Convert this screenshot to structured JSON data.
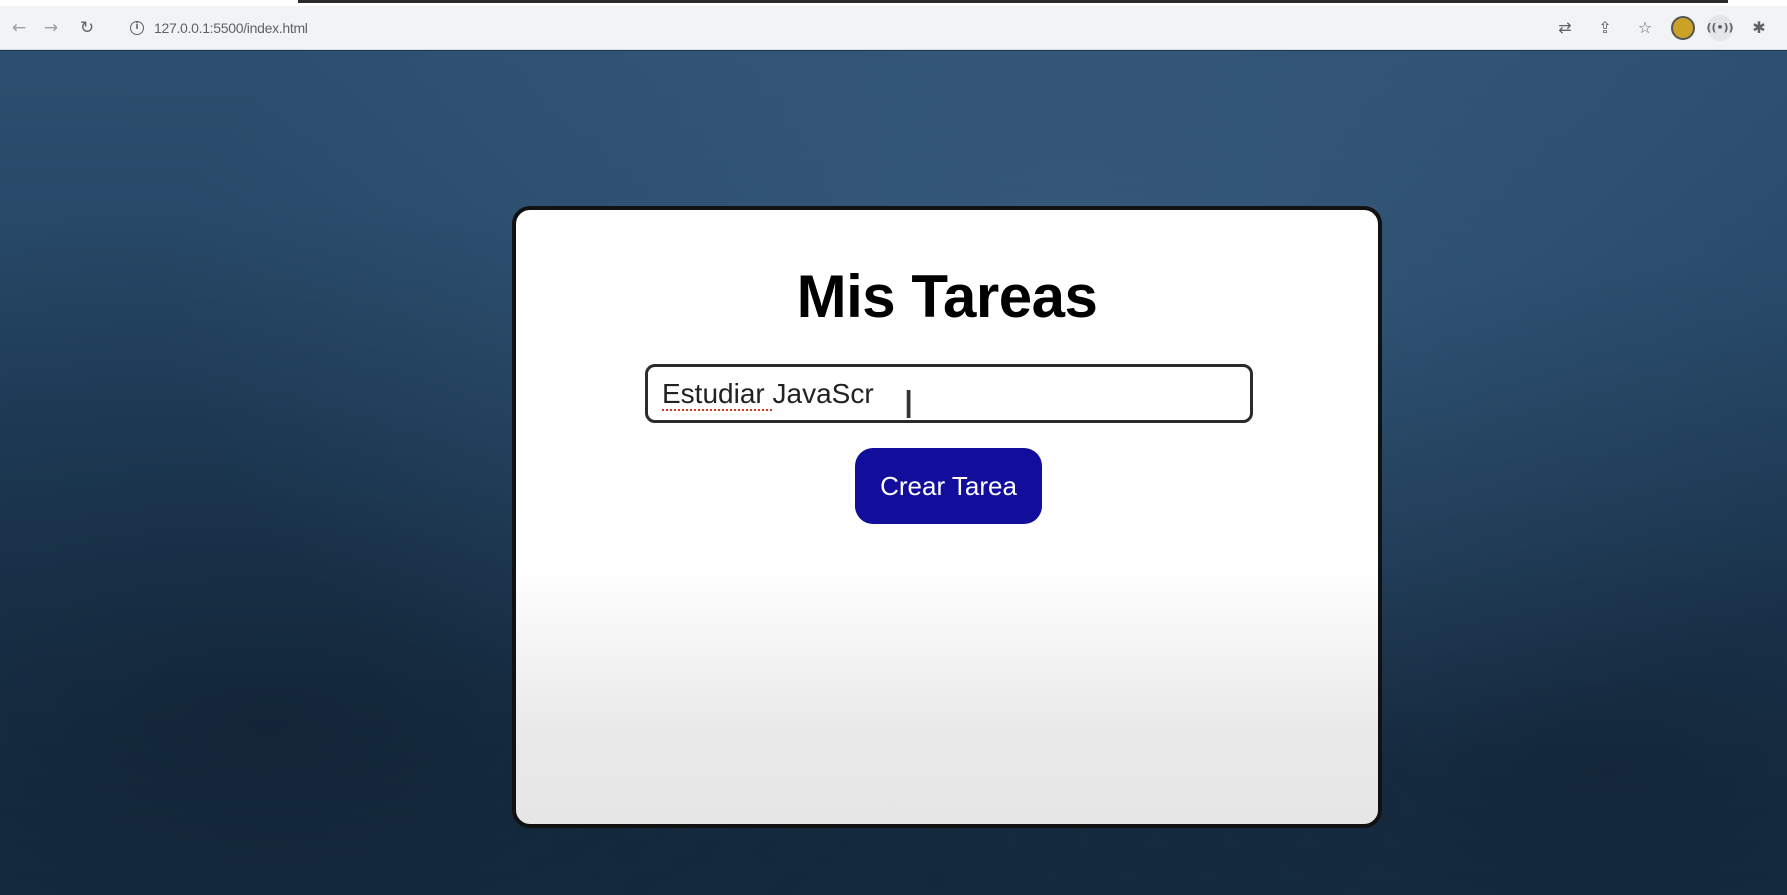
{
  "browser": {
    "url": "127.0.0.1:5500/index.html",
    "back_icon": "arrow-left-icon",
    "forward_icon": "arrow-right-icon",
    "reload_icon": "reload-icon",
    "site_info_icon": "info-icon",
    "toolbar_icons": [
      "translate-icon",
      "share-icon",
      "star-icon",
      "profile-icon",
      "media-icon",
      "extensions-icon"
    ]
  },
  "app": {
    "title": "Mis Tareas",
    "task_input_value": "Estudiar JavaScr",
    "create_button_label": "Crear Tarea",
    "accent_color": "#130d9c"
  }
}
